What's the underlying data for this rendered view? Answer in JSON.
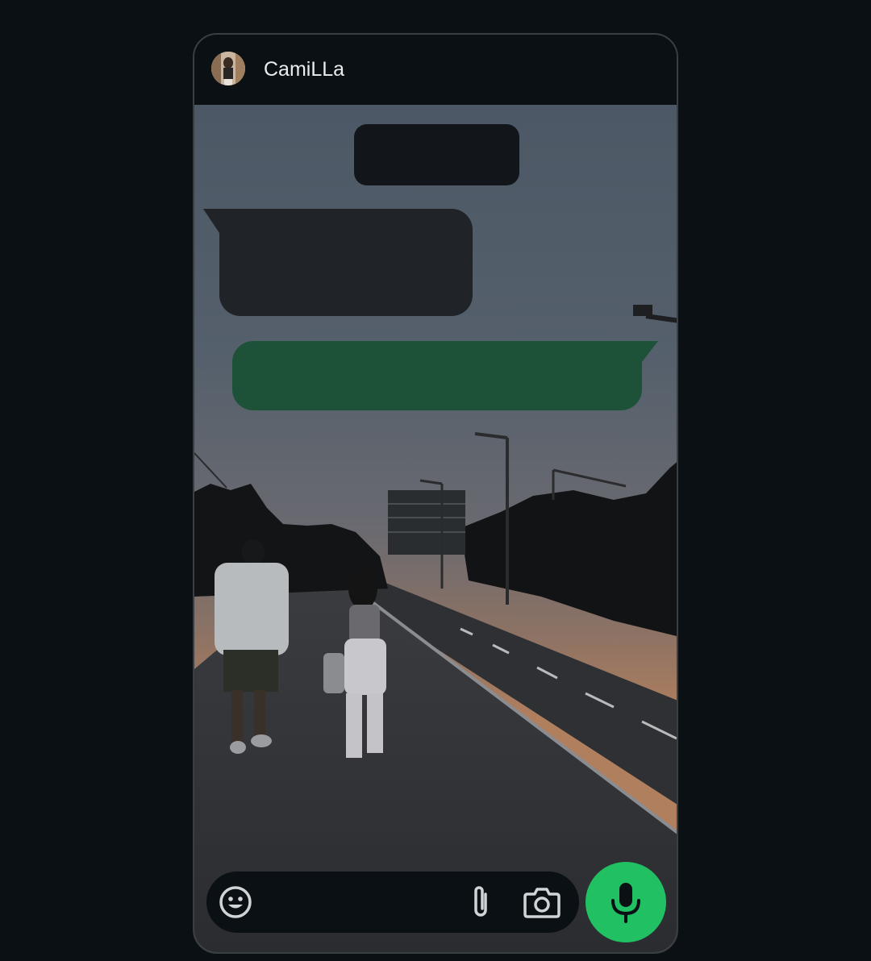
{
  "chat": {
    "contact_name": "CamiLLa",
    "avatar_icon": "avatar-photo"
  },
  "messages": [
    {
      "type": "system",
      "text": ""
    },
    {
      "type": "incoming",
      "text": ""
    },
    {
      "type": "outgoing",
      "text": ""
    }
  ],
  "composer": {
    "placeholder": "",
    "emoji_icon": "emoji-icon",
    "attach_icon": "paperclip-icon",
    "camera_icon": "camera-icon",
    "mic_icon": "microphone-icon"
  },
  "colors": {
    "background": "#0b1014",
    "incoming_bubble": "#202428",
    "outgoing_bubble": "#1d5239",
    "system_bubble": "#12161a",
    "mic_button": "#21c063",
    "icon": "#d0d4d7"
  }
}
